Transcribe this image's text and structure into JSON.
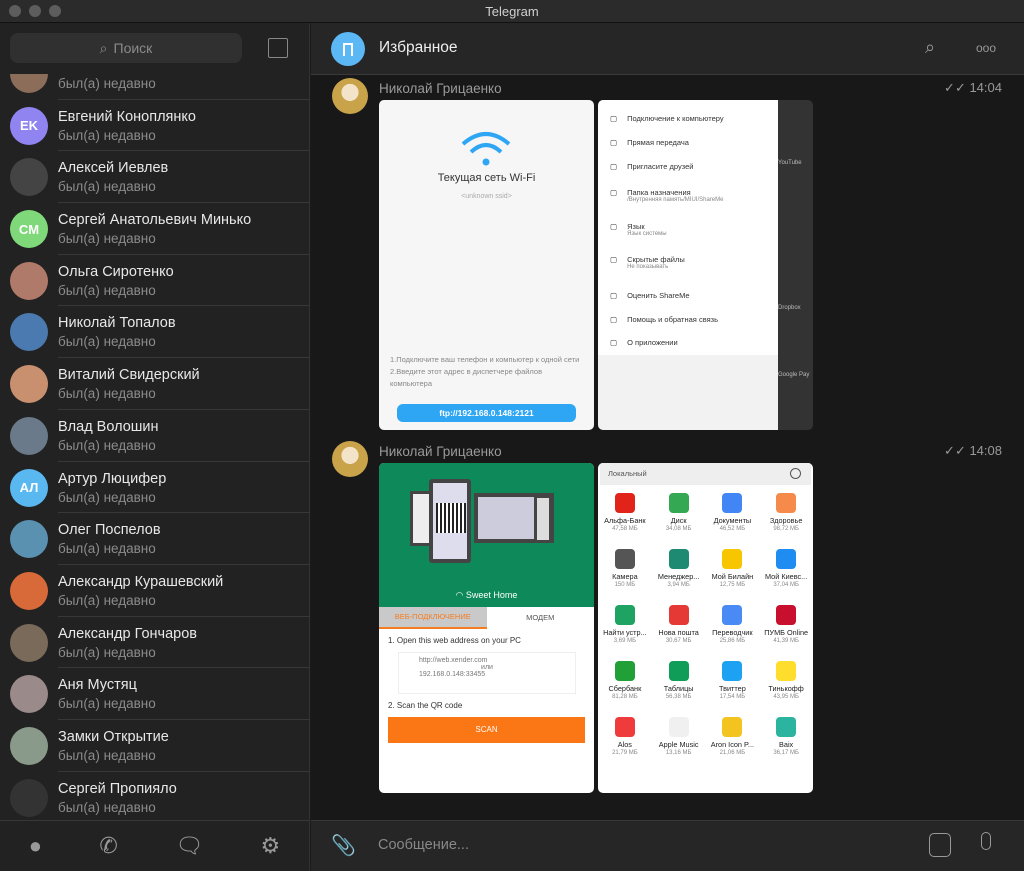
{
  "window": {
    "title": "Telegram"
  },
  "sidebar": {
    "search_placeholder": "Поиск",
    "contacts": [
      {
        "name": "",
        "status": "был(а) недавно",
        "initials": "",
        "color": "#8b6d5a"
      },
      {
        "name": "Евгений Коноплянко",
        "status": "был(а) недавно",
        "initials": "EK",
        "color": "#8f84f0"
      },
      {
        "name": "Алексей Иевлев",
        "status": "был(а) недавно",
        "initials": "",
        "color": "#444"
      },
      {
        "name": "Сергей Анатольевич Минько",
        "status": "был(а) недавно",
        "initials": "CM",
        "color": "#7fd97a"
      },
      {
        "name": "Ольга Сиротенко",
        "status": "был(а) недавно",
        "initials": "",
        "color": "#b07a6a"
      },
      {
        "name": "Николай Топалов",
        "status": "был(а) недавно",
        "initials": "",
        "color": "#4a7ab0"
      },
      {
        "name": "Виталий Свидерский",
        "status": "был(а) недавно",
        "initials": "",
        "color": "#c99070"
      },
      {
        "name": "Влад Волошин",
        "status": "был(а) недавно",
        "initials": "",
        "color": "#6a7a8a"
      },
      {
        "name": "Артур Люцифер",
        "status": "был(а) недавно",
        "initials": "АЛ",
        "color": "#5ab8f0"
      },
      {
        "name": "Олег Поспелов",
        "status": "был(а) недавно",
        "initials": "",
        "color": "#5a90b0"
      },
      {
        "name": "Александр Курашевский",
        "status": "был(а) недавно",
        "initials": "",
        "color": "#d86a3a"
      },
      {
        "name": "Александр Гончаров",
        "status": "был(а) недавно",
        "initials": "",
        "color": "#7a6a5a"
      },
      {
        "name": "Аня Мустяц",
        "status": "был(а) недавно",
        "initials": "",
        "color": "#9a8a8a"
      },
      {
        "name": "Замки Открытие",
        "status": "был(а) недавно",
        "initials": "",
        "color": "#8a9a8a"
      },
      {
        "name": "Сергей Пропияло",
        "status": "был(а) недавно",
        "initials": "",
        "color": "#333"
      }
    ]
  },
  "chat": {
    "title": "Избранное",
    "input_placeholder": "Сообщение...",
    "messages": [
      {
        "author": "Николай Грицаенко",
        "time": "14:04"
      },
      {
        "author": "Николай Грицаенко",
        "time": "14:08"
      }
    ]
  },
  "shareme_wifi": {
    "title": "Текущая сеть Wi-Fi",
    "ssid": "<unknown ssid>",
    "step1": "1.Подключите ваш телефон и компьютер к одной сети",
    "step2": "2.Введите этот адрес в диспетчере файлов компьютера",
    "address": "ftp://192.168.0.148:2121"
  },
  "shareme_menu": {
    "items": [
      {
        "label": "Подключение к компьютеру",
        "sub": ""
      },
      {
        "label": "Прямая передача",
        "sub": ""
      },
      {
        "label": "Пригласите друзей",
        "sub": ""
      },
      {
        "label": "Папка назначения",
        "sub": "/Внутренняя память/MIUI/ShareMe"
      },
      {
        "label": "Язык",
        "sub": "Язык системы"
      },
      {
        "label": "Скрытые файлы",
        "sub": "Не показывать"
      },
      {
        "label": "Оценить ShareMe",
        "sub": ""
      },
      {
        "label": "Помощь и обратная связь",
        "sub": ""
      },
      {
        "label": "О приложении",
        "sub": ""
      }
    ],
    "bg_apps": [
      {
        "name": "YouTube"
      },
      {
        "name": "Dropbox"
      },
      {
        "name": "Google Pay"
      }
    ]
  },
  "xender": {
    "network": "Sweet Home",
    "tab_active": "ВЕБ-ПОДКЛЮЧЕНИЕ",
    "tab_other": "МОДЕМ",
    "step1": "1. Open this web address on your PC",
    "url": "http://web.xender.com",
    "or": "или",
    "ip": "192.168.0.148:33455",
    "step2": "2. Scan the QR code",
    "scan": "SCAN"
  },
  "apps": {
    "header": "Локальный",
    "items": [
      {
        "name": "Альфа-Банк",
        "size": "47,58 МБ",
        "color": "#e2231a"
      },
      {
        "name": "Диск",
        "size": "34,08 МБ",
        "color": "#34a853"
      },
      {
        "name": "Документы",
        "size": "46,52 МБ",
        "color": "#4285f4"
      },
      {
        "name": "Здоровье",
        "size": "98,72 МБ",
        "color": "#f58a4b"
      },
      {
        "name": "Камера",
        "size": "150 МБ",
        "color": "#555"
      },
      {
        "name": "Менеджер...",
        "size": "3,94 МБ",
        "color": "#1e8a72"
      },
      {
        "name": "Мой Билайн",
        "size": "12,75 МБ",
        "color": "#f7c600"
      },
      {
        "name": "Мой Киевс...",
        "size": "37,04 МБ",
        "color": "#1e8cf0"
      },
      {
        "name": "Найти устр...",
        "size": "3,69 МБ",
        "color": "#1ea362"
      },
      {
        "name": "Нова пошта",
        "size": "30,67 МБ",
        "color": "#e53935"
      },
      {
        "name": "Переводчик",
        "size": "25,86 МБ",
        "color": "#4a8af4"
      },
      {
        "name": "ПУМБ Online",
        "size": "41,39 МБ",
        "color": "#c8102e"
      },
      {
        "name": "Сбербанк",
        "size": "81,28 МБ",
        "color": "#21a038"
      },
      {
        "name": "Таблицы",
        "size": "56,38 МБ",
        "color": "#0f9d58"
      },
      {
        "name": "Твиттер",
        "size": "17,54 МБ",
        "color": "#1da1f2"
      },
      {
        "name": "Тинькофф",
        "size": "43,95 МБ",
        "color": "#ffdd2d"
      },
      {
        "name": "Alos",
        "size": "21,79 МБ",
        "color": "#ef3b3b"
      },
      {
        "name": "Apple Music",
        "size": "13,16 МБ",
        "color": "#f0f0f0"
      },
      {
        "name": "Aron Icon P...",
        "size": "21,06 МБ",
        "color": "#f3c41f"
      },
      {
        "name": "Baix",
        "size": "36,17 МБ",
        "color": "#2bb5a0"
      }
    ]
  }
}
